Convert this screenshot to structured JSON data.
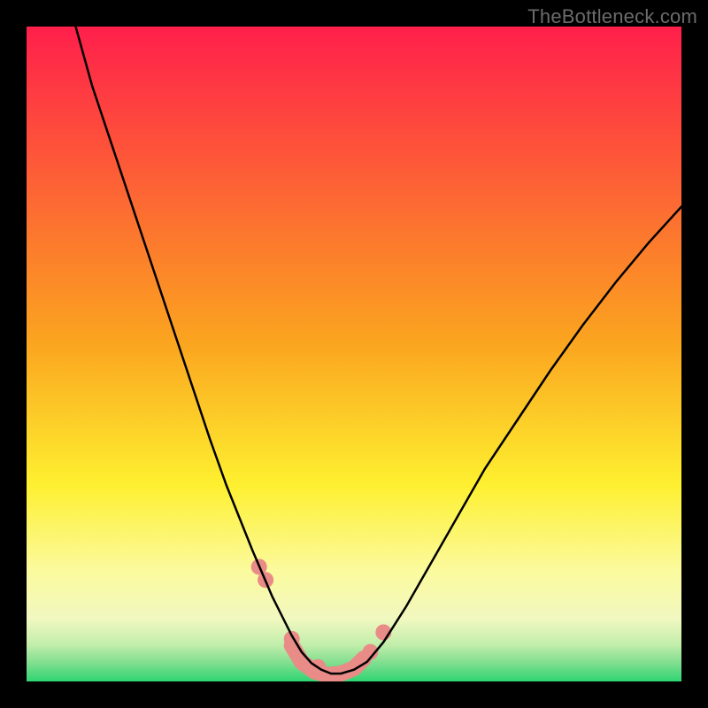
{
  "watermark": "TheBottleneck.com",
  "chart_data": {
    "type": "line",
    "title": "",
    "xlabel": "",
    "ylabel": "",
    "xlim": [
      0,
      1
    ],
    "ylim": [
      0,
      1
    ],
    "background_gradient": {
      "stops": [
        {
          "offset": 0.0,
          "color": "#ff1f4b"
        },
        {
          "offset": 0.48,
          "color": "#fba41f"
        },
        {
          "offset": 0.7,
          "color": "#fef030"
        },
        {
          "offset": 0.83,
          "color": "#fbfa9d"
        },
        {
          "offset": 0.905,
          "color": "#f1f8c0"
        },
        {
          "offset": 0.945,
          "color": "#c0edaa"
        },
        {
          "offset": 0.975,
          "color": "#77dd8c"
        },
        {
          "offset": 1.0,
          "color": "#2fd573"
        }
      ]
    },
    "series": [
      {
        "name": "curve",
        "type": "line",
        "color": "#000000",
        "stroke_width": 2.5,
        "x": [
          0.075,
          0.1,
          0.13,
          0.16,
          0.19,
          0.22,
          0.25,
          0.28,
          0.305,
          0.325,
          0.345,
          0.36,
          0.375,
          0.39,
          0.405,
          0.42,
          0.435,
          0.45,
          0.465,
          0.48,
          0.5,
          0.52,
          0.545,
          0.58,
          0.62,
          0.66,
          0.7,
          0.75,
          0.8,
          0.85,
          0.9,
          0.95,
          1.0
        ],
        "y": [
          1.0,
          0.91,
          0.82,
          0.73,
          0.64,
          0.55,
          0.46,
          0.37,
          0.3,
          0.25,
          0.2,
          0.165,
          0.13,
          0.1,
          0.07,
          0.045,
          0.028,
          0.018,
          0.012,
          0.012,
          0.018,
          0.03,
          0.06,
          0.115,
          0.185,
          0.255,
          0.325,
          0.4,
          0.475,
          0.545,
          0.61,
          0.67,
          0.725
        ]
      },
      {
        "name": "valley-markers",
        "type": "scatter",
        "color": "#e98b86",
        "radius": 9,
        "x": [
          0.355,
          0.365,
          0.405,
          0.445,
          0.475,
          0.525,
          0.545
        ],
        "y": [
          0.175,
          0.155,
          0.065,
          0.022,
          0.01,
          0.045,
          0.075
        ]
      },
      {
        "name": "valley-band",
        "type": "line",
        "color": "#e98b86",
        "stroke_width": 18,
        "x": [
          0.405,
          0.42,
          0.44,
          0.46,
          0.48,
          0.5,
          0.515
        ],
        "y": [
          0.055,
          0.03,
          0.015,
          0.01,
          0.012,
          0.02,
          0.035
        ]
      }
    ],
    "grid": false,
    "legend": false
  }
}
